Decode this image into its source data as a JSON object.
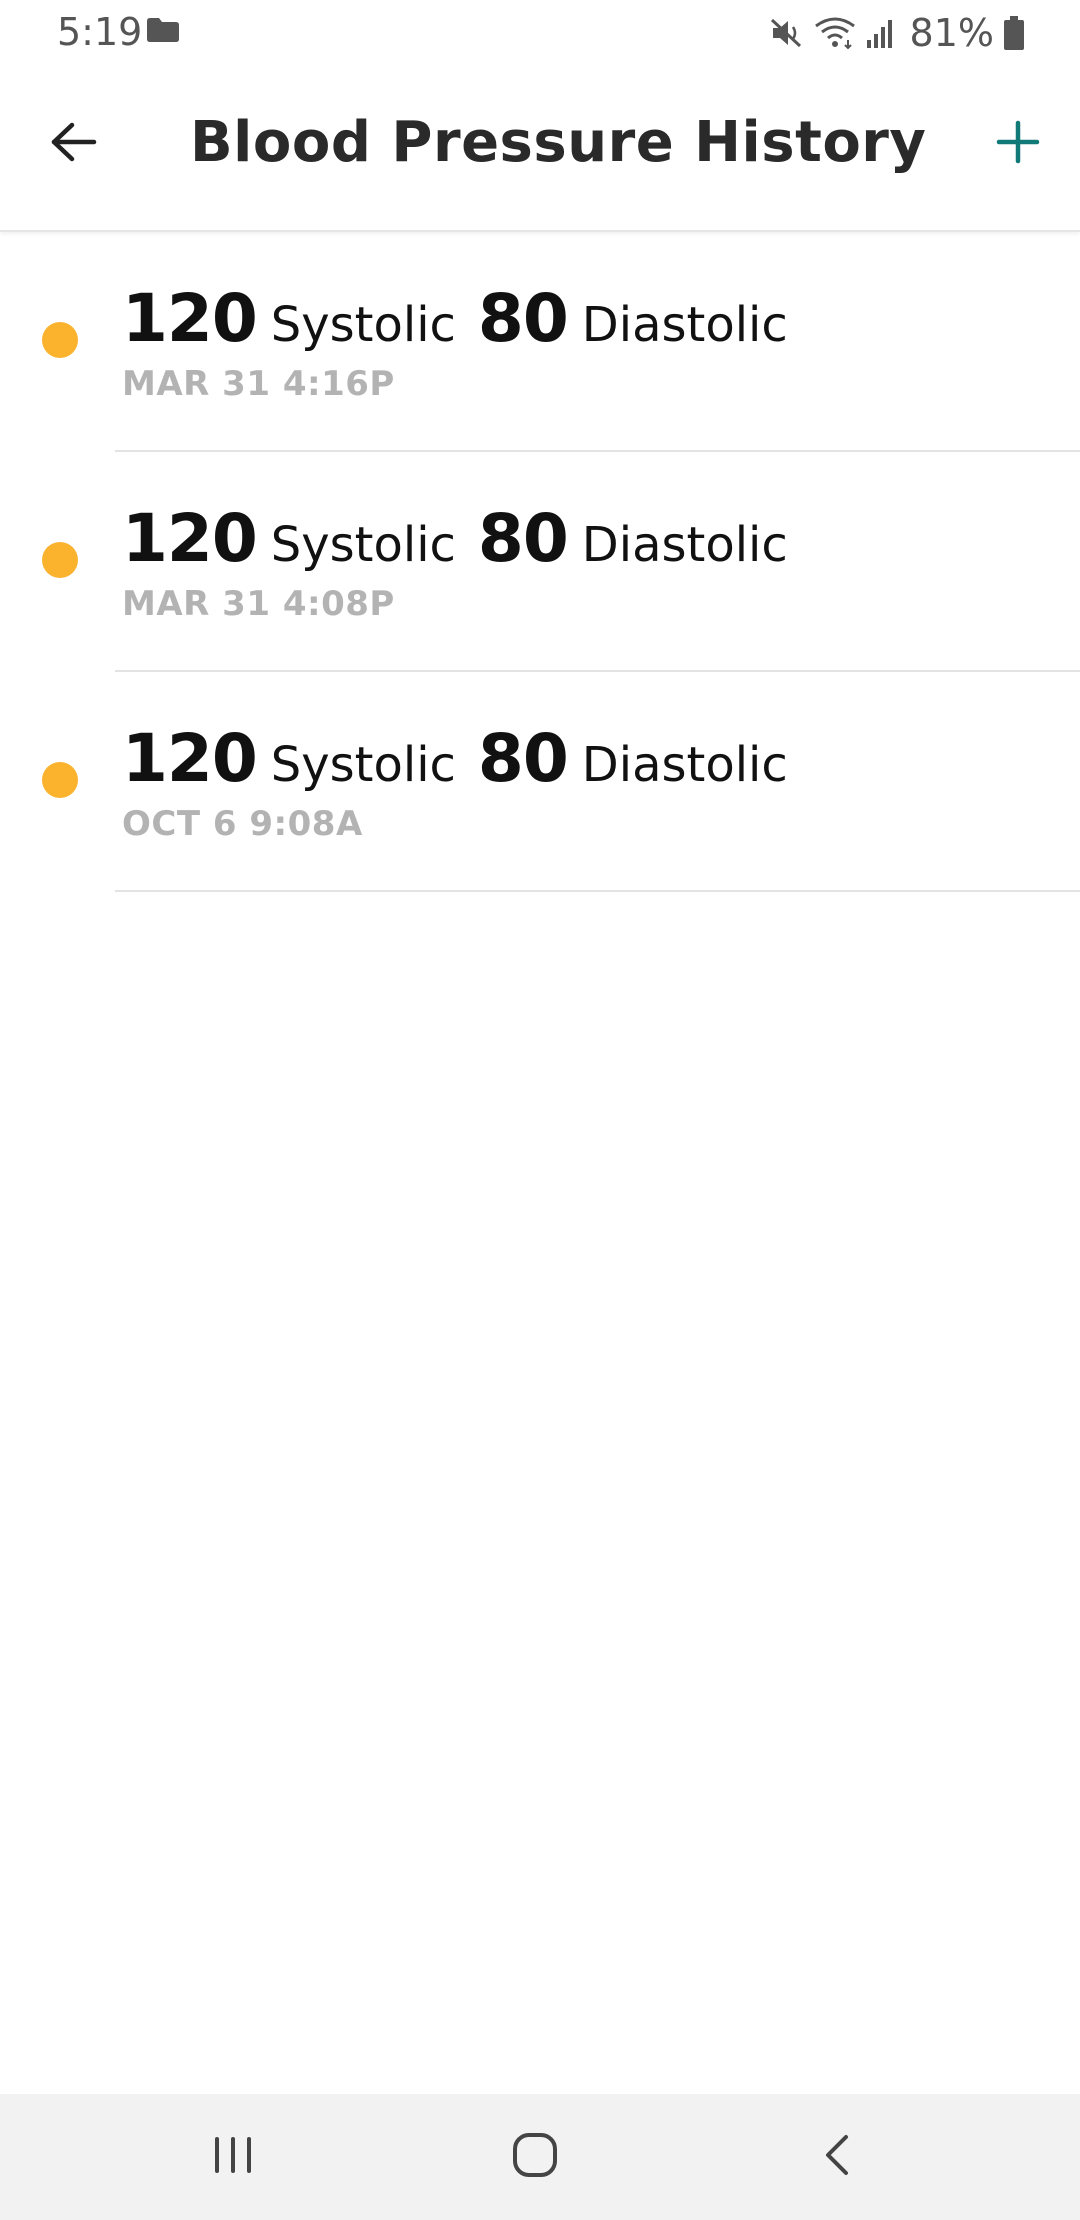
{
  "status_bar": {
    "time": "5:19",
    "battery": "81%",
    "icons": [
      "folder-icon",
      "mute-icon",
      "wifi-icon",
      "signal-icon",
      "battery-icon"
    ]
  },
  "header": {
    "title": "Blood Pressure History",
    "back_icon": "arrow-left-icon",
    "add_icon": "plus-icon",
    "accent_color": "#117a78"
  },
  "colors": {
    "status_dot": "#fbb22c",
    "date_text": "#b3b3b3"
  },
  "readings": [
    {
      "systolic": "120",
      "systolic_label": "Systolic",
      "diastolic": "80",
      "diastolic_label": "Diastolic",
      "date": "MAR 31 4:16P"
    },
    {
      "systolic": "120",
      "systolic_label": "Systolic",
      "diastolic": "80",
      "diastolic_label": "Diastolic",
      "date": "MAR 31 4:08P"
    },
    {
      "systolic": "120",
      "systolic_label": "Systolic",
      "diastolic": "80",
      "diastolic_label": "Diastolic",
      "date": "OCT 6 9:08A"
    }
  ],
  "nav_bar": {
    "items": [
      "recent-apps-icon",
      "home-icon",
      "back-icon"
    ]
  }
}
